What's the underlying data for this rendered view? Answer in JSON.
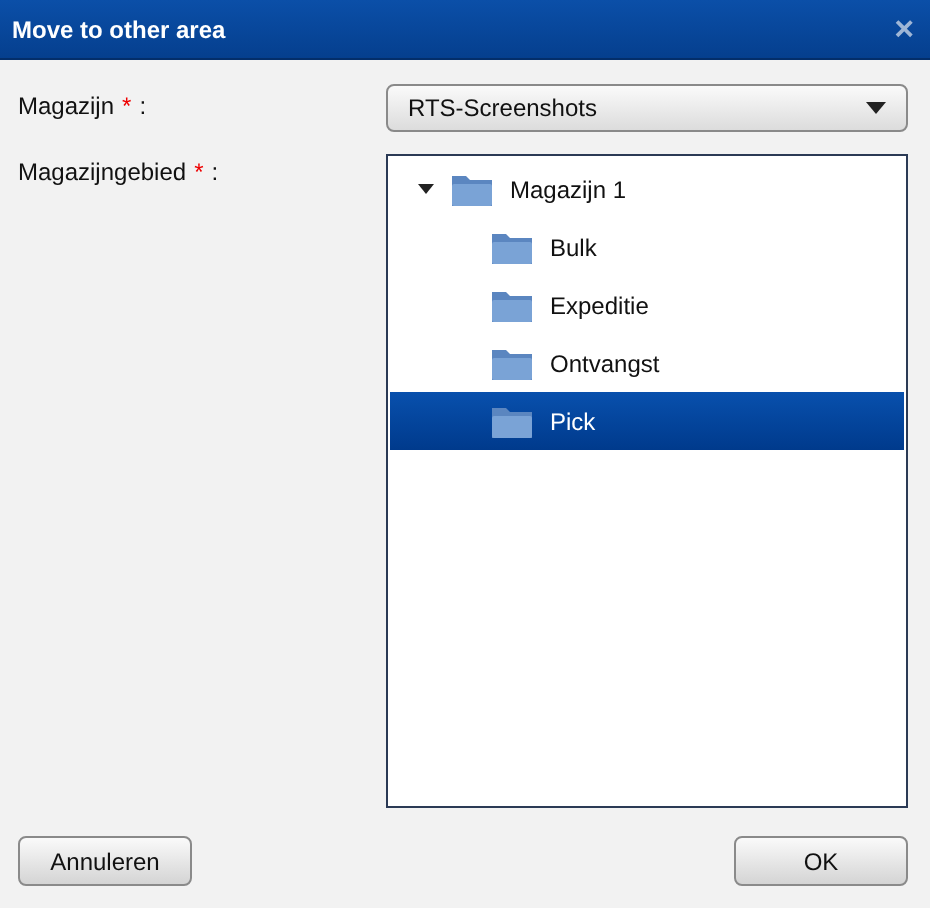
{
  "window": {
    "title": "Move to other area",
    "close": "×"
  },
  "fields": [
    {
      "label": "Magazijn",
      "required_mark": "*",
      "colon": ":"
    },
    {
      "label": "Magazijngebied",
      "required_mark": "*",
      "colon": ":"
    }
  ],
  "select": {
    "value": "RTS-Screenshots"
  },
  "tree": [
    {
      "label": "Magazijn 1",
      "expanded": true,
      "selected": false,
      "children": [
        {
          "label": "Bulk",
          "selected": false
        },
        {
          "label": "Expeditie",
          "selected": false
        },
        {
          "label": "Ontvangst",
          "selected": false
        },
        {
          "label": "Pick",
          "selected": true
        }
      ]
    }
  ],
  "buttons": [
    {
      "label": "Annuleren"
    },
    {
      "label": "OK"
    }
  ]
}
